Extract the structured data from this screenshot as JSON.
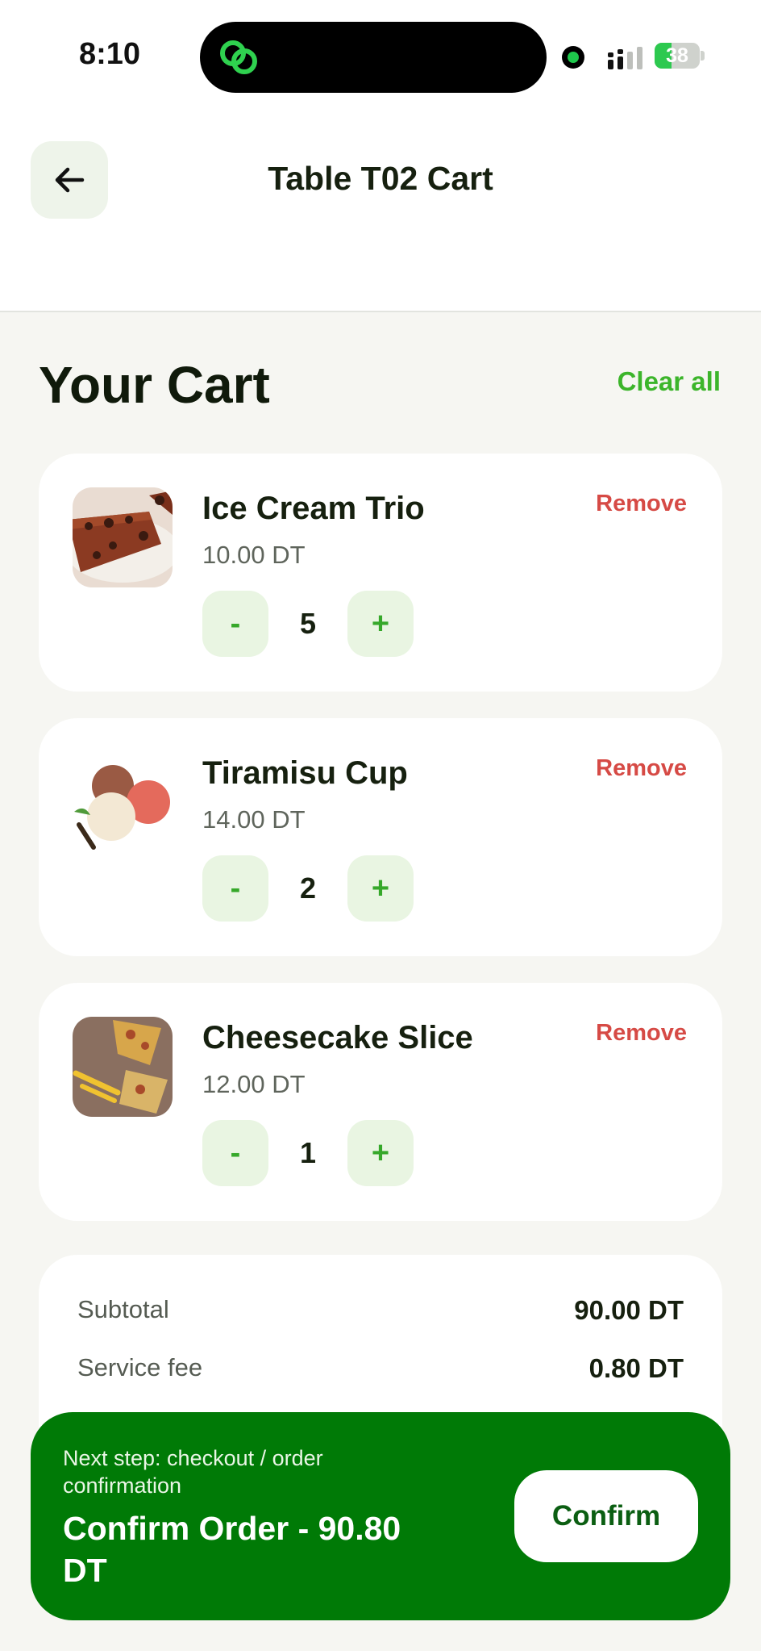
{
  "status_bar": {
    "time": "8:10",
    "battery_percent": "38",
    "battery_level": 0.38
  },
  "header": {
    "title": "Table T02 Cart",
    "back_icon": "arrow-left-icon"
  },
  "cart": {
    "title": "Your Cart",
    "clear_all_label": "Clear all",
    "items": [
      {
        "name": "Ice Cream Trio",
        "price": "10.00 DT",
        "quantity": "5",
        "remove_label": "Remove",
        "minus_label": "-",
        "plus_label": "+",
        "image": "chocolate-cake-slice"
      },
      {
        "name": "Tiramisu Cup",
        "price": "14.00 DT",
        "quantity": "2",
        "remove_label": "Remove",
        "minus_label": "-",
        "plus_label": "+",
        "image": "ice-cream-scoops"
      },
      {
        "name": "Cheesecake Slice",
        "price": "12.00 DT",
        "quantity": "1",
        "remove_label": "Remove",
        "minus_label": "-",
        "plus_label": "+",
        "image": "pizza-slices"
      }
    ]
  },
  "summary": {
    "subtotal_label": "Subtotal",
    "subtotal_value": "90.00 DT",
    "service_fee_label": "Service fee",
    "service_fee_value": "0.80 DT"
  },
  "checkout": {
    "next_step": "Next step: checkout / order confirmation",
    "confirm_order": "Confirm Order - 90.80 DT",
    "confirm_button": "Confirm"
  },
  "colors": {
    "accent_green": "#3cb52b",
    "checkout_bar": "#007a06",
    "remove_red": "#d64a45",
    "background": "#f6f6f2"
  }
}
